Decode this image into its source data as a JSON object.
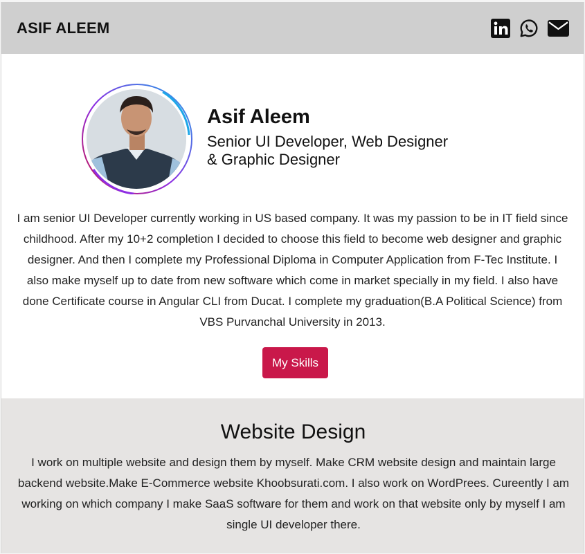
{
  "header": {
    "brand": "ASIF ALEEM",
    "icons": [
      "linkedin-icon",
      "whatsapp-icon",
      "email-icon"
    ]
  },
  "profile": {
    "name": "Asif Aleem",
    "role_line1": "Senior UI Developer, Web Designer",
    "role_line2": "& Graphic Designer",
    "bio": "I am senior UI Developer currently working in US based company. It was my passion to be in IT field since childhood. After my 10+2 completion I decided to choose this field to become web designer and graphic designer. And then I complete my Professional Diploma in Computer Application from F-Tec Institute. I also make myself up to date from new software which come in market specially in my field. I also have done Certificate course in Angular CLI from Ducat. I complete my graduation(B.A Political Science) from VBS Purvanchal University in 2013.",
    "skills_button": "My Skills"
  },
  "website_design": {
    "title": "Website Design",
    "text": "I work on multiple website and design them by myself. Make CRM website design and maintain large backend website.Make E-Commerce website Khoobsurati.com. I also work on WordPrees. Cureently I am working on which company I make SaaS software for them and work on that website only by myself I am single UI developer there."
  },
  "colors": {
    "header_bg": "#cfcfcf",
    "button_bg": "#c9184a",
    "section_bg": "#e6e4e3",
    "ring_gradient": [
      "#1ea7e8",
      "#8e2de2",
      "#c9184a"
    ]
  }
}
